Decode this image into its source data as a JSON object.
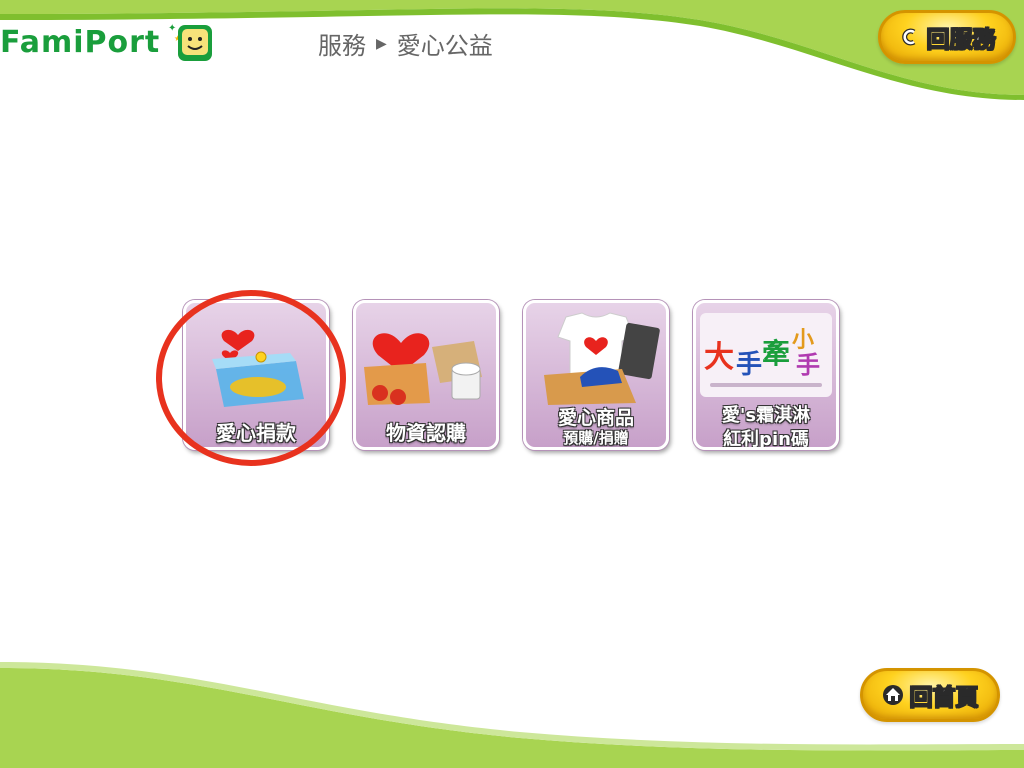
{
  "header": {
    "logo_text": "FamiPort",
    "breadcrumb": [
      "服務",
      "愛心公益"
    ],
    "back_button_label": "回服務"
  },
  "tiles": [
    {
      "id": "donation",
      "line1": "愛心捐款"
    },
    {
      "id": "supplies",
      "line1": "物資認購"
    },
    {
      "id": "goods",
      "line1": "愛心商品",
      "line2": "預購/捐贈"
    },
    {
      "id": "icecream",
      "line1": "愛's霜淇淋",
      "line2": "紅利pin碼",
      "logo_text": "大手牽小手"
    }
  ],
  "footer": {
    "home_button_label": "回首頁"
  },
  "colors": {
    "brand_green": "#1a9e3c",
    "wave_green": "#9fd14a",
    "tile_purple": "#c7a0c9",
    "button_gold": "#ffd21f",
    "highlight_red": "#e8321e"
  },
  "icons": [
    "smiley-phone-icon",
    "back-arrow-icon",
    "home-icon",
    "chevron-right-icon"
  ]
}
